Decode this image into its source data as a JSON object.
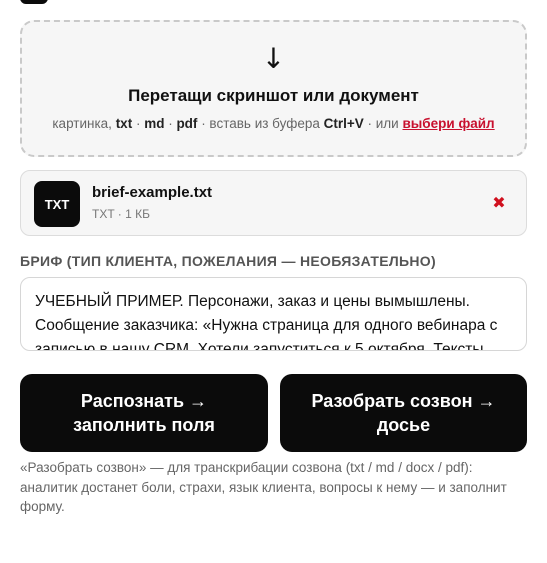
{
  "dropzone": {
    "arrow": "↓",
    "title": "Перетащи скриншот или документ",
    "sub_prefix": "картинка, ",
    "fmt_txt": "txt",
    "sep1": " · ",
    "fmt_md": "md",
    "sep2": " · ",
    "fmt_pdf": "pdf",
    "sub_middle": " · вставь из буфера ",
    "shortcut": "Ctrl+V",
    "sub_or": " · или ",
    "pick_link": "выбери файл"
  },
  "file": {
    "badge": "TXT",
    "name": "brief-example.txt",
    "meta": "TXT · 1 КБ",
    "remove_icon": "✖"
  },
  "brief": {
    "label": "БРИФ (ТИП КЛИЕНТА, ПОЖЕЛАНИЯ — НЕОБЯЗАТЕЛЬНО)",
    "value": "УЧЕБНЫЙ ПРИМЕР. Персонажи, заказ и цены вымышлены. Сообщение заказчика: «Нужна страница для одного вебинара с записью в нашу CRM. Хотели запуститься к 5 октября. Тексты"
  },
  "actions": {
    "recognize_label": "Распознать → заполнить поля",
    "parse_call_label": "Разобрать созвон → досье"
  },
  "hint": "«Разобрать созвон» — для транскрибации созвона (txt / md / docx / pdf): аналитик достанет боли, страхи, язык клиента, вопросы к нему — и заполнит форму."
}
